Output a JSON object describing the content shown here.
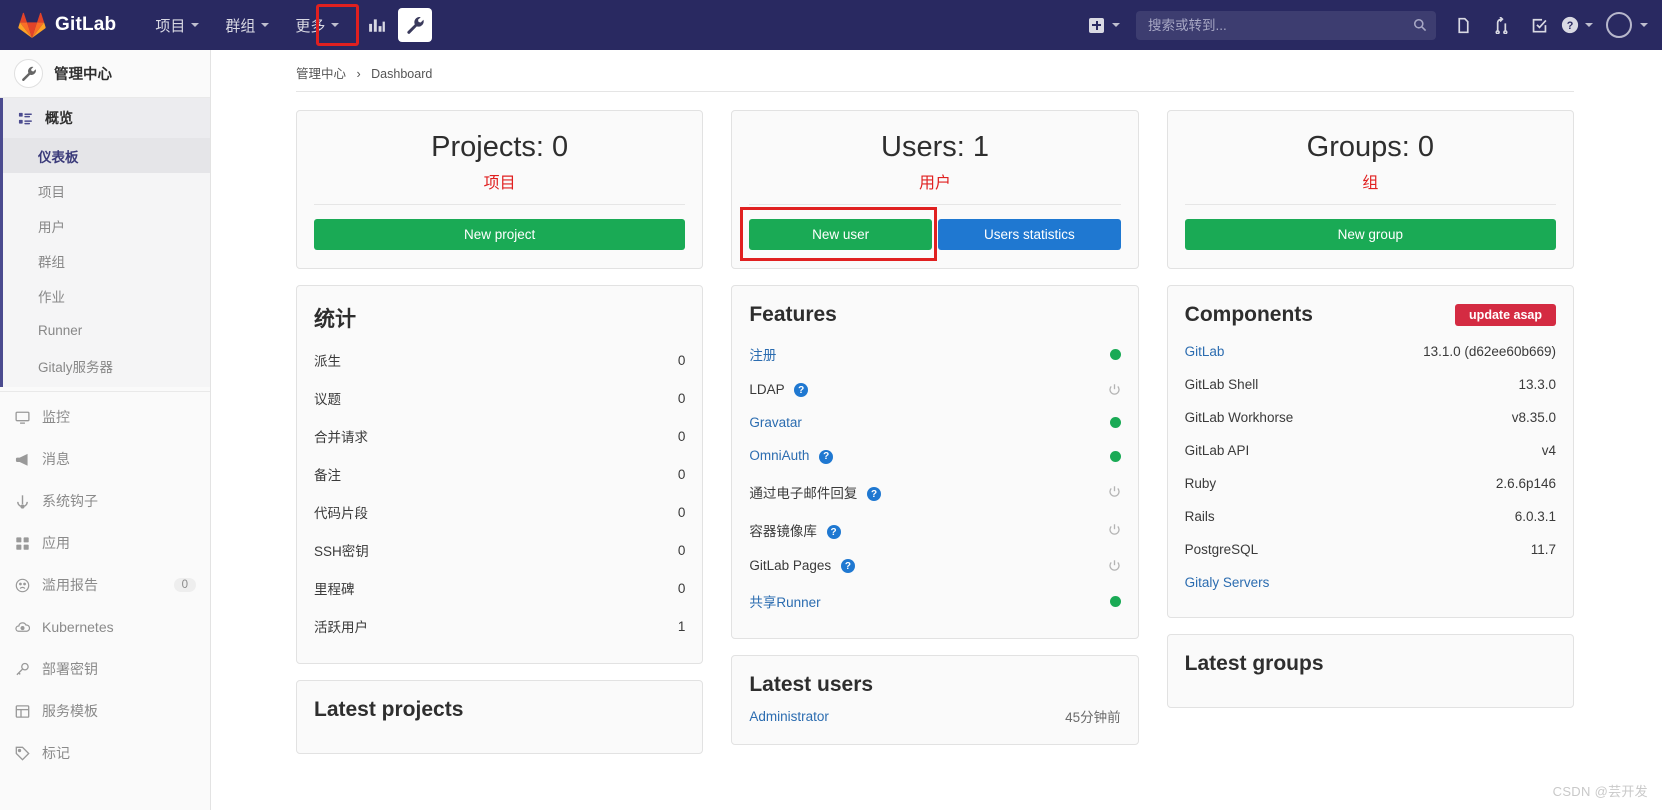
{
  "navbar": {
    "brand": "GitLab",
    "items": [
      {
        "label": "项目",
        "has_caret": true
      },
      {
        "label": "群组",
        "has_caret": true
      },
      {
        "label": "更多",
        "has_caret": true
      }
    ],
    "analytics_icon": "chart-bar-icon",
    "admin_icon": "wrench-icon",
    "admin_active": true,
    "plus_icon": "plus-square-icon",
    "search_placeholder": "搜索或转到...",
    "search_value": "",
    "search_icon": "search-icon",
    "right_icons": [
      {
        "name": "issues-icon"
      },
      {
        "name": "merge-requests-icon"
      },
      {
        "name": "todos-icon"
      },
      {
        "name": "help-icon"
      }
    ],
    "avatar_icon": "avatar"
  },
  "sidebar": {
    "header": {
      "title": "管理中心",
      "icon": "wrench-icon"
    },
    "overview": {
      "label": "概览",
      "icon": "overview-icon",
      "children": [
        {
          "label": "仪表板",
          "active": true
        },
        {
          "label": "项目",
          "active": false
        },
        {
          "label": "用户",
          "active": false
        },
        {
          "label": "群组",
          "active": false
        },
        {
          "label": "作业",
          "active": false
        },
        {
          "label": "Runner",
          "active": false
        },
        {
          "label": "Gitaly服务器",
          "active": false
        }
      ]
    },
    "items": [
      {
        "label": "监控",
        "icon": "monitor-icon",
        "badge": ""
      },
      {
        "label": "消息",
        "icon": "megaphone-icon",
        "badge": ""
      },
      {
        "label": "系统钩子",
        "icon": "hook-icon",
        "badge": ""
      },
      {
        "label": "应用",
        "icon": "apps-icon",
        "badge": ""
      },
      {
        "label": "滥用报告",
        "icon": "frown-icon",
        "badge": "0"
      },
      {
        "label": "Kubernetes",
        "icon": "kubernetes-icon",
        "badge": ""
      },
      {
        "label": "部署密钥",
        "icon": "key-icon",
        "badge": ""
      },
      {
        "label": "服务模板",
        "icon": "template-icon",
        "badge": ""
      },
      {
        "label": "标记",
        "icon": "label-icon",
        "badge": ""
      }
    ]
  },
  "breadcrumb": {
    "root": "管理中心",
    "current": "Dashboard"
  },
  "counts": {
    "projects": {
      "title": "Projects: 0",
      "annotation": "项目",
      "primary_button": "New project"
    },
    "users": {
      "title": "Users: 1",
      "annotation": "用户",
      "primary_button": "New user",
      "secondary_button": "Users statistics",
      "highlighted": true
    },
    "groups": {
      "title": "Groups: 0",
      "annotation": "组",
      "primary_button": "New group"
    }
  },
  "statistics": {
    "title": "统计",
    "rows": [
      {
        "label": "派生",
        "value": "0"
      },
      {
        "label": "议题",
        "value": "0"
      },
      {
        "label": "合并请求",
        "value": "0"
      },
      {
        "label": "备注",
        "value": "0"
      },
      {
        "label": "代码片段",
        "value": "0"
      },
      {
        "label": "SSH密钥",
        "value": "0"
      },
      {
        "label": "里程碑",
        "value": "0"
      },
      {
        "label": "活跃用户",
        "value": "1"
      }
    ]
  },
  "features": {
    "title": "Features",
    "rows": [
      {
        "label": "注册",
        "link": true,
        "help": false,
        "status": "on"
      },
      {
        "label": "LDAP",
        "link": false,
        "help": true,
        "status": "off"
      },
      {
        "label": "Gravatar",
        "link": true,
        "help": false,
        "status": "on"
      },
      {
        "label": "OmniAuth",
        "link": true,
        "help": true,
        "status": "on"
      },
      {
        "label": "通过电子邮件回复",
        "link": false,
        "help": true,
        "status": "off"
      },
      {
        "label": "容器镜像库",
        "link": false,
        "help": true,
        "status": "off"
      },
      {
        "label": "GitLab Pages",
        "link": false,
        "help": true,
        "status": "off"
      },
      {
        "label": "共享Runner",
        "link": true,
        "help": false,
        "status": "on"
      }
    ]
  },
  "components": {
    "title": "Components",
    "update_badge": "update asap",
    "rows": [
      {
        "label": "GitLab",
        "link": true,
        "value": "13.1.0 (d62ee60b669)"
      },
      {
        "label": "GitLab Shell",
        "link": false,
        "value": "13.3.0"
      },
      {
        "label": "GitLab Workhorse",
        "link": false,
        "value": "v8.35.0"
      },
      {
        "label": "GitLab API",
        "link": false,
        "value": "v4"
      },
      {
        "label": "Ruby",
        "link": false,
        "value": "2.6.6p146"
      },
      {
        "label": "Rails",
        "link": false,
        "value": "6.0.3.1"
      },
      {
        "label": "PostgreSQL",
        "link": false,
        "value": "11.7"
      }
    ],
    "footer_link": "Gitaly Servers"
  },
  "latest": {
    "projects": {
      "title": "Latest projects",
      "rows": []
    },
    "users": {
      "title": "Latest users",
      "rows": [
        {
          "name": "Administrator",
          "ago": "45分钟前"
        }
      ]
    },
    "groups": {
      "title": "Latest groups",
      "rows": []
    }
  },
  "watermark": "CSDN @芸开发"
}
